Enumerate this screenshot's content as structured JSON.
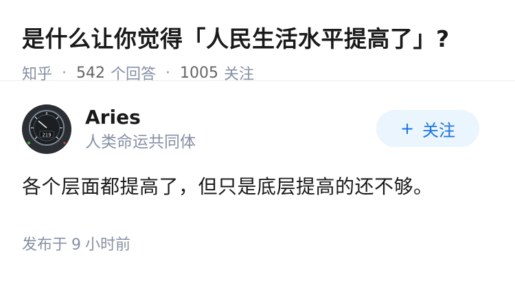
{
  "question": {
    "title": "是什么让你觉得「人民生活水平提高了」?",
    "source": "知乎",
    "separator": "·",
    "answer_count": "542",
    "answer_label": "个回答",
    "follow_count": "1005",
    "follow_label": "关注"
  },
  "answer": {
    "author_name": "Aries",
    "author_bio": "人类命运共同体",
    "follow_plus": "+",
    "follow_button_label": "关注",
    "content": "各个层面都提高了，但只是底层提高的还不够。",
    "time_prefix": "发布于",
    "time_value": "9",
    "time_suffix": "小时前"
  },
  "colors": {
    "meta_gray": "#8590a6",
    "accent_blue": "#1772f6",
    "button_bg": "#ebf5fd"
  },
  "avatar": {
    "description_icon": "speedometer-icon",
    "gauge_text": "219"
  }
}
